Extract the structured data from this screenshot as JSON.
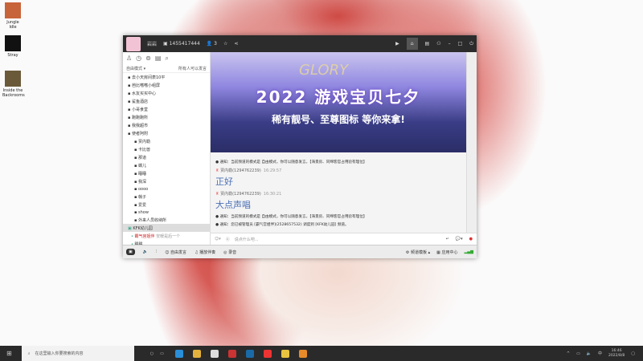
{
  "desktop": [
    {
      "label": "Jungle Idle"
    },
    {
      "label": "Stray"
    },
    {
      "label": "Inside the Backrooms"
    }
  ],
  "window": {
    "nickname": "岩岩",
    "id": "1455417444",
    "user_count": "3",
    "left": {
      "mode": "自由模式",
      "mode_hint": "所有人可以发言",
      "channels": [
        "去小天房间表10平",
        "芭比嗜嗜小组屏",
        "水友买买中心",
        "鲨鱼酒店",
        "小哥食堂",
        "跑跑跑所",
        "我我超市",
        "使者阿附"
      ],
      "subchannels": [
        "贾内勒",
        "卡比兽",
        "那道",
        "蝶儿",
        "睡睡",
        "我深",
        "oooo",
        "戟子",
        "爱爱",
        "show",
        "外来人员收纳所"
      ],
      "room": "KFK幼儿园",
      "users": [
        "霸气宫姐伴",
        "睡睡",
        "贾内勒"
      ],
      "user_note": "安暖是后一个"
    },
    "banner": {
      "glory": "GLORY",
      "title": "2022 游戏宝贝七夕",
      "subtitle": "稀有靓号、至尊图标 等你来拿!"
    },
    "chat": [
      {
        "type": "notice",
        "text": "通知：当前频道的模式是 自由模式，你可以随意发言。【海景房、同绵客官占用验有理位】"
      },
      {
        "type": "msg",
        "sender": "贾内勒(1294762239)",
        "time": "16:29:57",
        "text": "正好"
      },
      {
        "type": "msg",
        "sender": "贾内勒(1294762239)",
        "time": "16:30:21",
        "text": "大点声唱"
      },
      {
        "type": "notice",
        "text": "通知：当前频道的模式是 自由模式，你可以随意发言。【海景房、同绵客官占用验有理位】"
      },
      {
        "type": "notice",
        "text": "通知：您已被管理员 [霸气宫姐伴](2528657532) 调度到 [KFK幼儿园] 频道。"
      }
    ],
    "input_placeholder": "说点什么吧...",
    "bottom": {
      "free_speak": "自由发言",
      "music": "播放伴奏",
      "record": "录音",
      "channel_template": "频道模板",
      "app_center": "应用中心"
    }
  },
  "taskbar": {
    "search_placeholder": "在这里输入你要搜索的内容",
    "time": "16:46",
    "date": "2022/8/8"
  }
}
